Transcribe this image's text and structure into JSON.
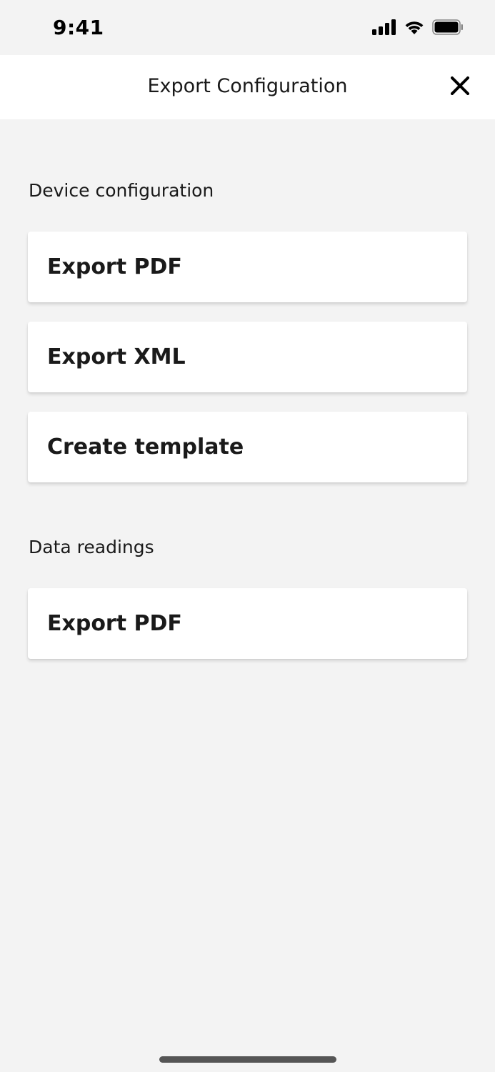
{
  "status_bar": {
    "time": "9:41",
    "icons": [
      "signal-icon",
      "wifi-icon",
      "battery-icon"
    ]
  },
  "header": {
    "title": "Export Configuration",
    "close_icon": "close-icon"
  },
  "sections": {
    "device": {
      "title": "Device configuration",
      "items": [
        {
          "label": "Export PDF"
        },
        {
          "label": "Export XML"
        },
        {
          "label": "Create template"
        }
      ]
    },
    "readings": {
      "title": "Data readings",
      "items": [
        {
          "label": "Export PDF"
        }
      ]
    }
  },
  "colors": {
    "background": "#f3f3f3",
    "card": "#ffffff",
    "text": "#1a1a1a"
  }
}
